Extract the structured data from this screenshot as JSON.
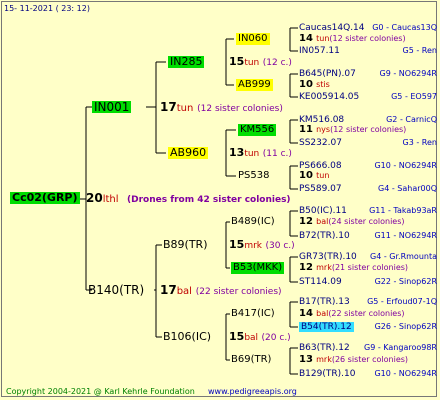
{
  "header": {
    "date": "15- 11-2021 ( 23: 12)"
  },
  "footer": {
    "copyright": "Copyright 2004-2021 @ Karl Kehrle Foundation",
    "site": "www.pedigreeapis.org"
  },
  "root": {
    "label": "Cc02(GRP)",
    "num": "20",
    "sub": "lthl",
    "note": "(Drones from 42 sister colonies)"
  },
  "gen1": [
    {
      "label": "IN001",
      "num": "17",
      "sub": "tun",
      "note": "(12 sister colonies)"
    },
    {
      "label": "B140(TR)",
      "num": "17",
      "sub": "bal",
      "note": "(22 sister colonies)"
    }
  ],
  "gen2": [
    {
      "label": "IN285",
      "num": "15",
      "sub": "tun",
      "note": "(12 c.)"
    },
    {
      "label": "AB960",
      "num": "13",
      "sub": "tun",
      "note": "(11 c.)"
    },
    {
      "label": "B89(TR)",
      "num": "15",
      "sub": "mrk",
      "note": "(30 c.)"
    },
    {
      "label": "B106(IC)",
      "num": "15",
      "sub": "bal",
      "note": "(20 c.)"
    }
  ],
  "gen3": [
    {
      "label": "IN060",
      "num": "14",
      "sub": "tun",
      "note": "(12 sister colonies)"
    },
    {
      "label": "AB999",
      "num": "10",
      "sub": "stis",
      "note": ""
    },
    {
      "label": "KM556",
      "num": "11",
      "sub": "nys",
      "note": "(12 sister colonies)"
    },
    {
      "label": "PS538",
      "num": "10",
      "sub": "tun",
      "note": ""
    },
    {
      "label": "B489(IC)",
      "num": "12",
      "sub": "bal",
      "note": "(24 sister colonies)"
    },
    {
      "label": "B53(MKK)",
      "num": "12",
      "sub": "mrk",
      "note": "(21 sister colonies)"
    },
    {
      "label": "B417(IC)",
      "num": "14",
      "sub": "bal",
      "note": "(22 sister colonies)"
    },
    {
      "label": "B69(TR)",
      "num": "13",
      "sub": "mrk",
      "note": "(26 sister colonies)"
    }
  ],
  "gen4": [
    {
      "id": "Caucas14Q.14",
      "tail": "G0 - Caucas13Q"
    },
    {
      "id": "IN057.11",
      "tail": "G5 - Ren"
    },
    {
      "id": "B645(PN).07",
      "tail": "G9 - NO6294R"
    },
    {
      "id": "KE005914.05",
      "tail": "G5 - EO597"
    },
    {
      "id": "KM516.08",
      "tail": "G2 - CarnicQ"
    },
    {
      "id": "SS232.07",
      "tail": "G3 - Ren"
    },
    {
      "id": "PS666.08",
      "tail": "G10 - NO6294R"
    },
    {
      "id": "PS589.07",
      "tail": "G4 - Sahar00Q"
    },
    {
      "id": "B50(IC).11",
      "tail": "G11 - Takab93aR"
    },
    {
      "id": "B72(TR).10",
      "tail": "G11 - NO6294R"
    },
    {
      "id": "GR73(TR).10",
      "tail": "G4 - Gr.Rmounta"
    },
    {
      "id": "ST114.09",
      "tail": "G22 - Sinop62R"
    },
    {
      "id": "B17(TR).13",
      "tail": "G5 - Erfoud07-1Q"
    },
    {
      "id": "B54(TR).12",
      "tail": "G26 - Sinop62R"
    },
    {
      "id": "B63(TR).12",
      "tail": "G9 - Kangaroo98R"
    },
    {
      "id": "B129(TR).10",
      "tail": "G10 - NO6294R"
    }
  ]
}
